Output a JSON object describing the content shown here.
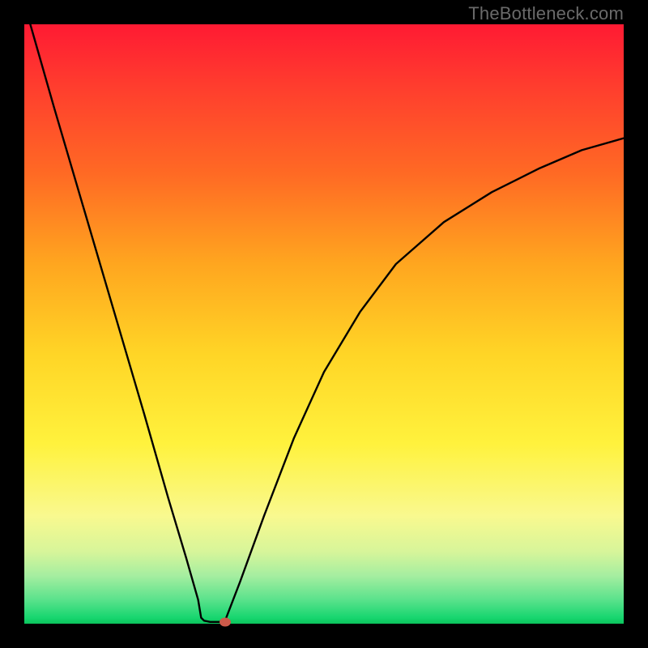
{
  "watermark": "TheBottleneck.com",
  "chart_data": {
    "type": "line",
    "title": "",
    "xlabel": "",
    "ylabel": "",
    "xlim": [
      0,
      1
    ],
    "ylim": [
      0,
      1
    ],
    "series": [
      {
        "name": "left-descent",
        "x": [
          0.01,
          0.05,
          0.1,
          0.15,
          0.2,
          0.24,
          0.27,
          0.29,
          0.295
        ],
        "y": [
          1.0,
          0.86,
          0.69,
          0.52,
          0.35,
          0.21,
          0.11,
          0.04,
          0.01
        ]
      },
      {
        "name": "valley",
        "x": [
          0.295,
          0.3,
          0.31,
          0.325,
          0.335
        ],
        "y": [
          0.01,
          0.005,
          0.003,
          0.003,
          0.005
        ]
      },
      {
        "name": "right-ascent",
        "x": [
          0.335,
          0.36,
          0.4,
          0.45,
          0.5,
          0.56,
          0.62,
          0.7,
          0.78,
          0.86,
          0.93,
          1.0
        ],
        "y": [
          0.005,
          0.07,
          0.18,
          0.31,
          0.42,
          0.52,
          0.6,
          0.67,
          0.72,
          0.76,
          0.79,
          0.81
        ]
      }
    ],
    "marker": {
      "x": 0.335,
      "y": 0.003
    },
    "background_gradient": {
      "top": "#ff1a33",
      "mid": "#fff23d",
      "bottom": "#0cc45c"
    }
  }
}
